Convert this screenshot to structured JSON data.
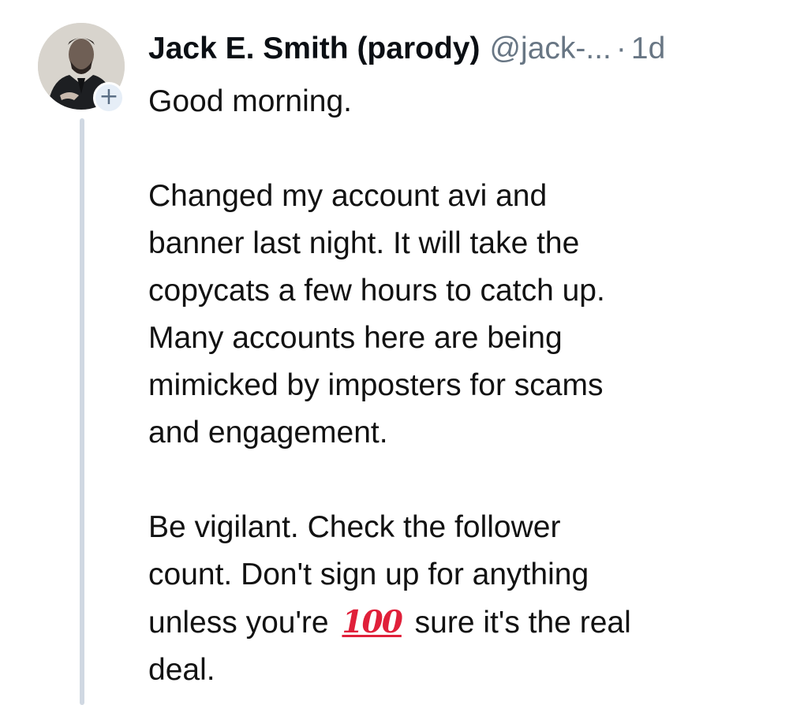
{
  "post": {
    "author": {
      "display_name": "Jack E. Smith (parody)",
      "handle": "@jack-...",
      "separator": "·",
      "time": "1d",
      "avatar_icon": "profile-photo",
      "follow_icon": "plus-icon",
      "follow_label": "+"
    },
    "paragraphs": [
      "Good morning.",
      "Changed my account avi and\nbanner last night. It will take the\ncopycats a few hours to catch up.\nMany accounts here are being\nmimicked by imposters for scams\nand engagement.",
      "Be vigilant. Check the follower\ncount. Don't sign up for anything\nunless you're 💯 sure it's the real\ndeal."
    ],
    "last_paragraph_parts": {
      "before": "Be vigilant. Check the follower\ncount. Don't sign up for anything\nunless you're ",
      "emoji": "100",
      "emoji_name": "hundred-points-emoji",
      "after": " sure it's the real\ndeal."
    },
    "colors": {
      "thread_line": "#d0d8e2",
      "meta_text": "#687684",
      "emoji_red": "#e0203a"
    }
  }
}
